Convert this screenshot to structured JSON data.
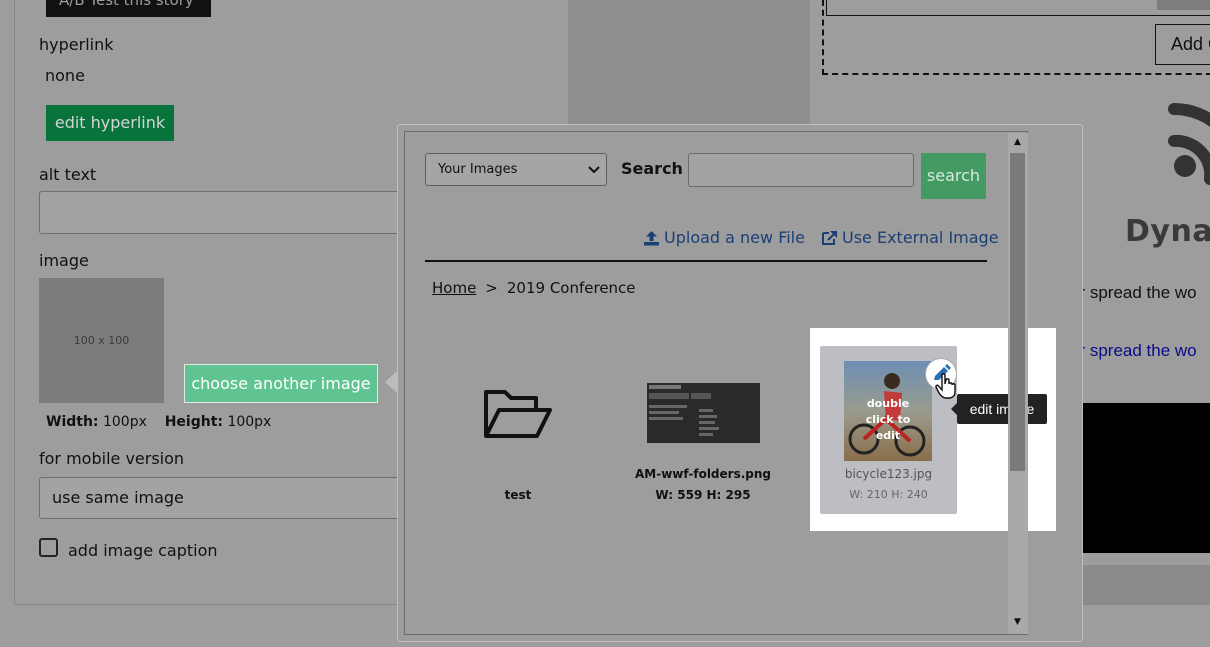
{
  "editor": {
    "ab_test_label": "A/B Test this story",
    "hyperlink_label": "hyperlink",
    "hyperlink_value": "none",
    "edit_hyperlink_label": "edit hyperlink",
    "alt_text_label": "alt text",
    "alt_text_value": "",
    "image_label": "image",
    "placeholder_text": "100 x 100",
    "choose_image_label": "choose another image",
    "width_label": "Width:",
    "width_value": "100px",
    "height_label": "Height:",
    "height_value": "100px",
    "mobile_label": "for mobile version",
    "mobile_value": "use same image",
    "caption_label": "add image caption"
  },
  "right_panel": {
    "add_label": "Add C",
    "dynam_text": "Dynam",
    "spread_text": "or spread the wo",
    "spread_link_text": "or spread the wo"
  },
  "modal": {
    "source_select": "Your Images",
    "search_label": "Search",
    "search_placeholder": "",
    "search_button": "search",
    "upload_link": "Upload a new File",
    "external_link": "Use External Image",
    "breadcrumb": {
      "home": "Home",
      "separator": ">",
      "current": "2019 Conference"
    },
    "items": [
      {
        "type": "folder",
        "name": "test"
      },
      {
        "type": "image",
        "name": "AM-wwf-folders.png",
        "dims": "W: 559 H: 295"
      },
      {
        "type": "image",
        "name": "bicycle123.jpg",
        "dims": "W: 210 H: 240",
        "overlay_text": "double click to edit"
      }
    ],
    "tooltip": "edit image"
  },
  "colors": {
    "overlay_grey": "#9d9d9d",
    "green_button": "#08743c",
    "choose_button": "#5fc492",
    "search_button": "#439a62",
    "link_blue": "#1b3f74"
  }
}
